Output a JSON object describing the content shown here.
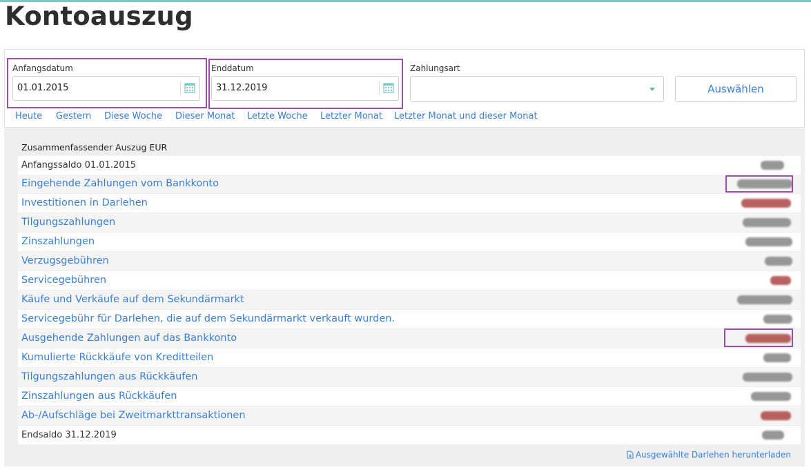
{
  "page": {
    "title": "Kontoauszug"
  },
  "filters": {
    "start_label": "Anfangsdatum",
    "start_value": "01.01.2015",
    "end_label": "Enddatum",
    "end_value": "31.12.2019",
    "payment_label": "Zahlungsart",
    "payment_value": "",
    "select_button": "Auswählen",
    "quick_links": [
      "Heute",
      "Gestern",
      "Diese Woche",
      "Dieser Monat",
      "Letzte Woche",
      "Letzter Monat",
      "Letzter Monat und dieser Monat"
    ]
  },
  "summary": {
    "title": "Zusammenfassender Auszug EUR",
    "rows": [
      {
        "label": "Anfangssaldo 01.01.2015",
        "link": false
      },
      {
        "label": "Eingehende Zahlungen vom Bankkonto",
        "link": true
      },
      {
        "label": "Investitionen in Darlehen",
        "link": true
      },
      {
        "label": "Tilgungszahlungen",
        "link": true
      },
      {
        "label": "Zinszahlungen",
        "link": true
      },
      {
        "label": "Verzugsgebühren",
        "link": true
      },
      {
        "label": "Servicegebühren",
        "link": true
      },
      {
        "label": "Käufe und Verkäufe auf dem Sekundärmarkt",
        "link": true
      },
      {
        "label": "Servicegebühr für Darlehen, die auf dem Sekundärmarkt verkauft wurden.",
        "link": true
      },
      {
        "label": "Ausgehende Zahlungen auf das Bankkonto",
        "link": true
      },
      {
        "label": "Kumulierte Rückkäufe von Kreditteilen",
        "link": true
      },
      {
        "label": "Tilgungszahlungen aus Rückkäufen",
        "link": true
      },
      {
        "label": "Zinszahlungen aus Rückkäufen",
        "link": true
      },
      {
        "label": "Ab-/Aufschläge bei Zweitmarkttransaktionen",
        "link": true
      },
      {
        "label": "Endsaldo 31.12.2019",
        "link": false
      }
    ],
    "download_label": "Ausgewählte Darlehen herunterladen"
  },
  "colors": {
    "accent": "#3a7fd5",
    "highlight": "#9b4fa8",
    "topline": "#7fc6c6",
    "panel_bg": "#efefef"
  },
  "icons": {
    "calendar": "calendar-icon",
    "dropdown": "chevron-down-icon",
    "download": "document-download-icon"
  }
}
